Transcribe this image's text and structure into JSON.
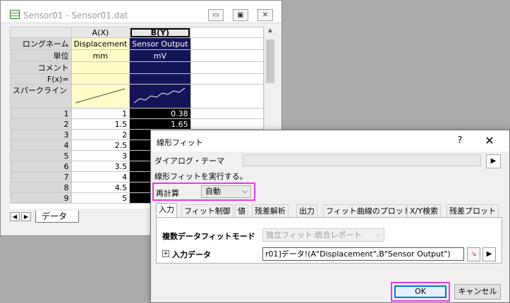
{
  "workbook": {
    "title": "Sensor01 - Sensor01.dat",
    "minimize_icon": "minimize-icon",
    "restore_icon": "restore-icon",
    "close_icon": "close-icon",
    "columns": {
      "a": "A(X)",
      "b": "B(Y)"
    },
    "meta_rows": [
      {
        "label": "ロングネーム",
        "a": "Displacement",
        "b": "Sensor Output"
      },
      {
        "label": "単位",
        "a": "mm",
        "b": "mV"
      },
      {
        "label": "コメント",
        "a": "",
        "b": ""
      },
      {
        "label": "F(x)=",
        "a": "",
        "b": ""
      }
    ],
    "sparkline_label": "スパークライン",
    "data_rows": [
      {
        "n": "1",
        "a": "1",
        "b": "0.38"
      },
      {
        "n": "2",
        "a": "1.5",
        "b": "1.65"
      },
      {
        "n": "3",
        "a": "2",
        "b": ""
      },
      {
        "n": "4",
        "a": "2.5",
        "b": ""
      },
      {
        "n": "5",
        "a": "3",
        "b": ""
      },
      {
        "n": "6",
        "a": "3.5",
        "b": ""
      },
      {
        "n": "7",
        "a": "4",
        "b": ""
      },
      {
        "n": "8",
        "a": "4.5",
        "b": ""
      },
      {
        "n": "9",
        "a": "5",
        "b": ""
      }
    ],
    "sheet_tab": "データ"
  },
  "dialog": {
    "title": "線形フィット",
    "help": "?",
    "close": "✕",
    "theme_label": "ダイアログ・テーマ",
    "description": "線形フィットを実行する。",
    "recalc_label": "再計算",
    "recalc_value": "自動",
    "tabs": [
      "入力",
      "フィット制御",
      "値",
      "残差解析",
      "出力",
      "フィット曲線のプロット",
      "X/Y検索",
      "残差プロット"
    ],
    "multi_fit_label": "複数データフィットモード",
    "multi_fit_value": "独立フィット:統合レポート",
    "input_label": "入力データ",
    "input_value": "r01]データ!(A\"Displacement\",B\"Sensor Output\")",
    "ok": "OK",
    "cancel": "キャンセル"
  }
}
